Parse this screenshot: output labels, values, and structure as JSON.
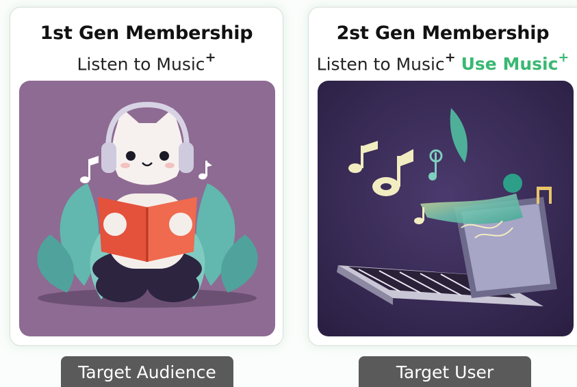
{
  "cards": [
    {
      "title": "1st Gen Membership",
      "subtitle_text": "Listen to Music",
      "subtitle_mark": "+",
      "badge": "Target Audience"
    },
    {
      "title": "2st Gen Membership",
      "subtitle_text": "Listen to Music",
      "subtitle_mark": "+",
      "accent_text": "Use Music",
      "accent_mark": "+",
      "badge": "Target User"
    }
  ],
  "colors": {
    "accent": "#3ab873",
    "badge_bg": "#5a5a5a",
    "left_art_bg": "#8e6b93",
    "right_art_bg": "#3a2c58"
  },
  "icons": {
    "left_art": "cat-reading-with-headphones-illustration",
    "right_art": "laptop-with-music-notes-illustration"
  }
}
